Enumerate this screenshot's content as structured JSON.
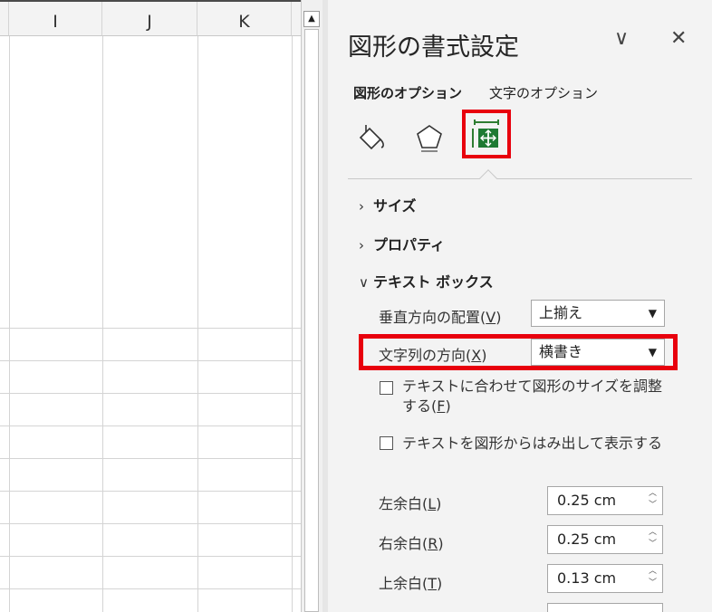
{
  "sheet": {
    "columns": [
      "I",
      "J",
      "K"
    ]
  },
  "scrollbar": {
    "up_glyph": "▲"
  },
  "pane": {
    "title": "図形の書式設定",
    "controls": {
      "collapse_glyph": "∨",
      "close_glyph": "✕"
    },
    "tabs": [
      {
        "label": "図形のオプション",
        "active": true
      },
      {
        "label": "文字のオプション",
        "active": false
      }
    ],
    "icons": [
      {
        "name": "fill-line-icon",
        "selected": false
      },
      {
        "name": "effects-icon",
        "selected": false
      },
      {
        "name": "size-properties-icon",
        "selected": true
      }
    ],
    "sections": [
      {
        "label": "サイズ",
        "expanded": false
      },
      {
        "label": "プロパティ",
        "expanded": false
      },
      {
        "label": "テキスト ボックス",
        "expanded": true
      }
    ],
    "chevron_collapsed": "›",
    "chevron_expanded": "∨",
    "textbox": {
      "valign_label": "垂直方向の配置(",
      "valign_key": "V",
      "valign_value": "上揃え",
      "direction_label": "文字列の方向(",
      "direction_key": "X",
      "direction_value": "横書き",
      "autofit_line1": "テキストに合わせて図形のサイズを調整",
      "autofit_line2_prefix": "する(",
      "autofit_key": "F",
      "overflow_label": "テキストを図形からはみ出して表示する",
      "margins": [
        {
          "label": "左余白(",
          "key": "L",
          "value": "0.25 cm"
        },
        {
          "label": "右余白(",
          "key": "R",
          "value": "0.25 cm"
        },
        {
          "label": "上余白(",
          "key": "T",
          "value": "0.13 cm"
        }
      ],
      "paren_close": ")",
      "dropdown_arrow": "▼",
      "spin_up": "︿",
      "spin_down": "﹀"
    }
  }
}
